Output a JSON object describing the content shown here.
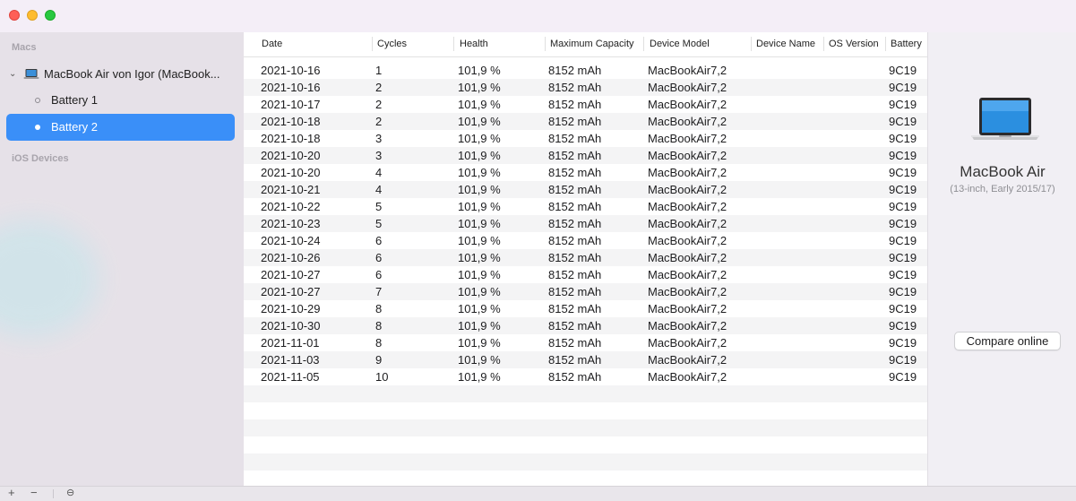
{
  "window": {
    "traffic_lights": {
      "close": "#fe5f57",
      "minimize": "#febc2e",
      "maximize": "#28c840"
    }
  },
  "sidebar": {
    "macs_header": "Macs",
    "mac_label": "MacBook Air von Igor (MacBook...",
    "batteries": [
      {
        "label": "Battery 1",
        "selected": false
      },
      {
        "label": "Battery 2",
        "selected": true
      }
    ],
    "ios_header": "iOS Devices",
    "selected_color": "#3a8ff8"
  },
  "table": {
    "columns": [
      "Date",
      "Cycles",
      "Health",
      "Maximum Capacity",
      "Device Model",
      "Device Name",
      "OS Version",
      "Battery"
    ],
    "rows": [
      [
        "2021-10-16",
        "1",
        "101,9 %",
        "8152 mAh",
        "MacBookAir7,2",
        "",
        "",
        "9C19"
      ],
      [
        "2021-10-16",
        "2",
        "101,9 %",
        "8152 mAh",
        "MacBookAir7,2",
        "",
        "",
        "9C19"
      ],
      [
        "2021-10-17",
        "2",
        "101,9 %",
        "8152 mAh",
        "MacBookAir7,2",
        "",
        "",
        "9C19"
      ],
      [
        "2021-10-18",
        "2",
        "101,9 %",
        "8152 mAh",
        "MacBookAir7,2",
        "",
        "",
        "9C19"
      ],
      [
        "2021-10-18",
        "3",
        "101,9 %",
        "8152 mAh",
        "MacBookAir7,2",
        "",
        "",
        "9C19"
      ],
      [
        "2021-10-20",
        "3",
        "101,9 %",
        "8152 mAh",
        "MacBookAir7,2",
        "",
        "",
        "9C19"
      ],
      [
        "2021-10-20",
        "4",
        "101,9 %",
        "8152 mAh",
        "MacBookAir7,2",
        "",
        "",
        "9C19"
      ],
      [
        "2021-10-21",
        "4",
        "101,9 %",
        "8152 mAh",
        "MacBookAir7,2",
        "",
        "",
        "9C19"
      ],
      [
        "2021-10-22",
        "5",
        "101,9 %",
        "8152 mAh",
        "MacBookAir7,2",
        "",
        "",
        "9C19"
      ],
      [
        "2021-10-23",
        "5",
        "101,9 %",
        "8152 mAh",
        "MacBookAir7,2",
        "",
        "",
        "9C19"
      ],
      [
        "2021-10-24",
        "6",
        "101,9 %",
        "8152 mAh",
        "MacBookAir7,2",
        "",
        "",
        "9C19"
      ],
      [
        "2021-10-26",
        "6",
        "101,9 %",
        "8152 mAh",
        "MacBookAir7,2",
        "",
        "",
        "9C19"
      ],
      [
        "2021-10-27",
        "6",
        "101,9 %",
        "8152 mAh",
        "MacBookAir7,2",
        "",
        "",
        "9C19"
      ],
      [
        "2021-10-27",
        "7",
        "101,9 %",
        "8152 mAh",
        "MacBookAir7,2",
        "",
        "",
        "9C19"
      ],
      [
        "2021-10-29",
        "8",
        "101,9 %",
        "8152 mAh",
        "MacBookAir7,2",
        "",
        "",
        "9C19"
      ],
      [
        "2021-10-30",
        "8",
        "101,9 %",
        "8152 mAh",
        "MacBookAir7,2",
        "",
        "",
        "9C19"
      ],
      [
        "2021-11-01",
        "8",
        "101,9 %",
        "8152 mAh",
        "MacBookAir7,2",
        "",
        "",
        "9C19"
      ],
      [
        "2021-11-03",
        "9",
        "101,9 %",
        "8152 mAh",
        "MacBookAir7,2",
        "",
        "",
        "9C19"
      ],
      [
        "2021-11-05",
        "10",
        "101,9 %",
        "8152 mAh",
        "MacBookAir7,2",
        "",
        "",
        "9C19"
      ]
    ]
  },
  "detail": {
    "device_icon": "macbook-air-icon",
    "device_name": "MacBook Air",
    "device_subtitle": "(13-inch, Early 2015/17)",
    "compare_button": "Compare online"
  },
  "bottombar": {
    "add_symbol": "+",
    "remove_symbol": "−",
    "options_symbol": "⊖"
  }
}
